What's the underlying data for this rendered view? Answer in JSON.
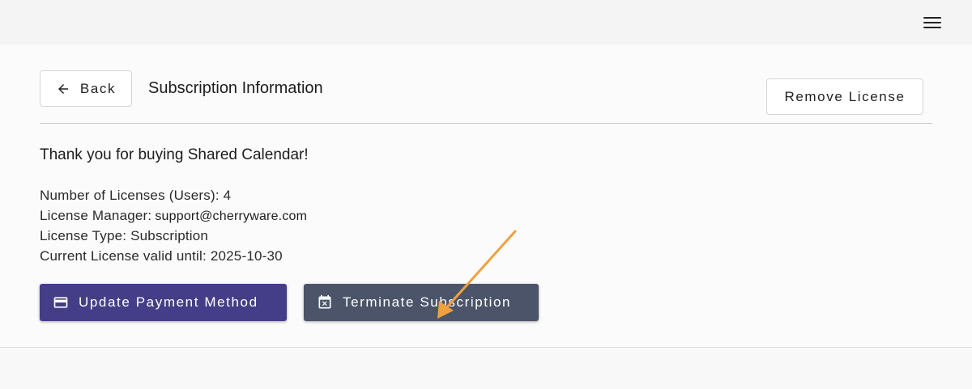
{
  "header": {
    "menu_icon": "hamburger-menu-icon"
  },
  "toolbar": {
    "back_label": "Back",
    "back_icon": "arrow-left-icon",
    "title": "Subscription Information",
    "remove_label": "Remove License"
  },
  "main": {
    "thank_you": "Thank you for buying Shared Calendar!",
    "licenses_line": "Number of Licenses (Users): 4",
    "manager_label": "License Manager:",
    "manager_email": "support@cherryware.com",
    "type_line": "License Type: Subscription",
    "valid_line": "Current License valid until: 2025-10-30"
  },
  "actions": {
    "update_payment_label": "Update Payment Method",
    "update_payment_icon": "credit-card-icon",
    "terminate_label": "Terminate Subscription",
    "terminate_icon": "calendar-remove-icon"
  },
  "colors": {
    "primary_button": "#443e88",
    "secondary_button": "#4b5469",
    "annotation_arrow": "#f0a040"
  }
}
